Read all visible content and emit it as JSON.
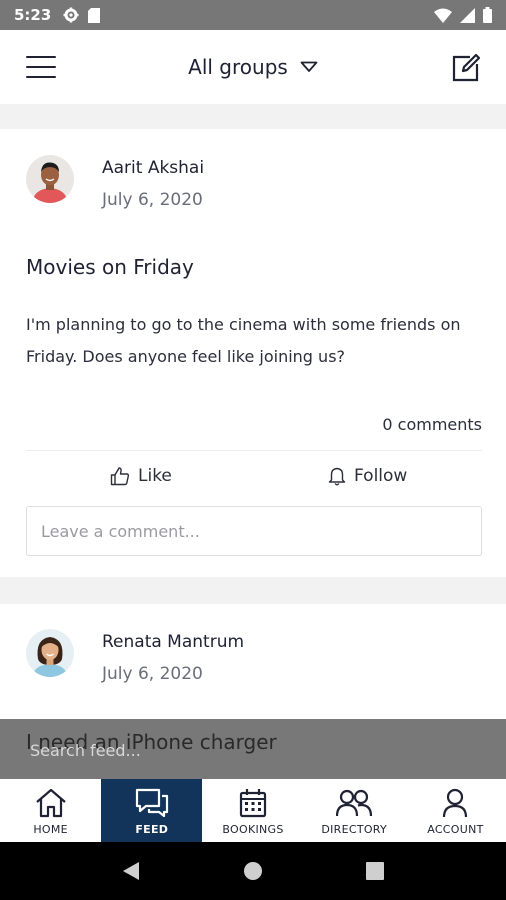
{
  "status_bar": {
    "time": "5:23"
  },
  "header": {
    "group_selector": "All groups"
  },
  "posts": [
    {
      "author": "Aarit Akshai",
      "date": "July 6, 2020",
      "title": "Movies on Friday",
      "body": "I'm planning to go to the cinema with some friends on Friday. Does anyone feel like joining us?",
      "comments_count": "0 comments",
      "like_label": "Like",
      "follow_label": "Follow",
      "comment_placeholder": "Leave a comment..."
    },
    {
      "author": "Renata Mantrum",
      "date": "July 6, 2020",
      "title": "I need an iPhone charger"
    }
  ],
  "search": {
    "placeholder": "Search feed..."
  },
  "tabs": [
    {
      "label": "HOME",
      "icon": "home-icon"
    },
    {
      "label": "FEED",
      "icon": "chat-icon",
      "active": true
    },
    {
      "label": "BOOKINGS",
      "icon": "calendar-icon"
    },
    {
      "label": "DIRECTORY",
      "icon": "people-icon"
    },
    {
      "label": "ACCOUNT",
      "icon": "person-icon"
    }
  ],
  "colors": {
    "accent": "#12345a",
    "text": "#1f2233",
    "status_bar": "#777777"
  }
}
